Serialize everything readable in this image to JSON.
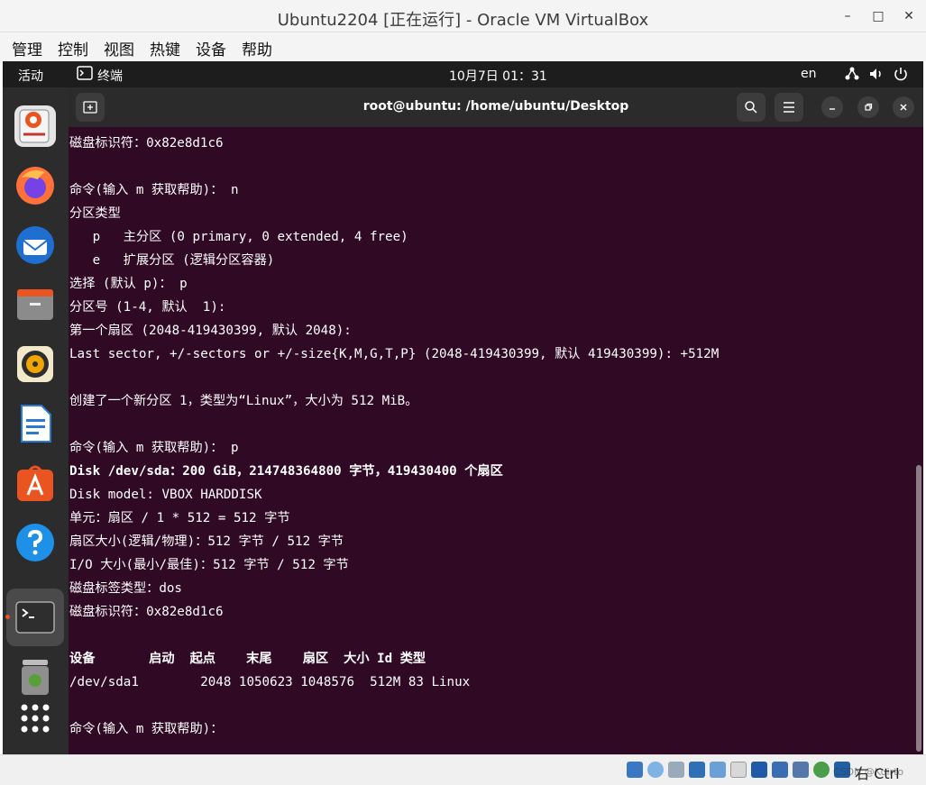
{
  "window": {
    "title": "Ubuntu2204 [正在运行] - Oracle VM VirtualBox",
    "minimize": "–",
    "maximize": "□",
    "close": "✕"
  },
  "menubar": [
    "管理",
    "控制",
    "视图",
    "热键",
    "设备",
    "帮助"
  ],
  "topbar": {
    "activities": "活动",
    "app_icon": "terminal-icon",
    "app_name": "终端",
    "clock": "10月7日 01：31",
    "lang": "en"
  },
  "dock": [
    "ubuntu-software-icon",
    "firefox-icon",
    "thunderbird-icon",
    "files-icon",
    "rhythmbox-icon",
    "libreoffice-writer-icon",
    "app-center-icon",
    "help-icon",
    "terminal-icon",
    "trash-icon",
    "show-apps-icon"
  ],
  "terminal": {
    "title": "root@ubuntu: /home/ubuntu/Desktop",
    "lines": [
      "磁盘标识符：0x82e8d1c6",
      "",
      "命令(输入 m 获取帮助)： n",
      "分区类型",
      "   p   主分区 (0 primary, 0 extended, 4 free)",
      "   e   扩展分区 (逻辑分区容器)",
      "选择 (默认 p)： p",
      "分区号 (1-4, 默认  1):",
      "第一个扇区 (2048-419430399, 默认 2048):",
      "Last sector, +/-sectors or +/-size{K,M,G,T,P} (2048-419430399, 默认 419430399): +512M",
      "",
      "创建了一个新分区 1，类型为“Linux”，大小为 512 MiB。",
      "",
      "命令(输入 m 获取帮助)： p",
      "Disk /dev/sda：200 GiB，214748364800 字节，419430400 个扇区",
      "Disk model: VBOX HARDDISK",
      "单元：扇区 / 1 * 512 = 512 字节",
      "扇区大小(逻辑/物理)：512 字节 / 512 字节",
      "I/O 大小(最小/最佳)：512 字节 / 512 字节",
      "磁盘标签类型：dos",
      "磁盘标识符：0x82e8d1c6",
      "",
      "设备       启动  起点    末尾    扇区  大小 Id 类型",
      "/dev/sda1        2048 1050623 1048576  512M 83 Linux",
      "",
      "命令(输入 m 获取帮助)："
    ],
    "bold_lines": [
      14,
      22
    ]
  },
  "statusbar": {
    "host_key": "右 Ctrl",
    "watermark": "CSDN @Kuirto"
  },
  "colors": {
    "terminal_bg": "#300a24",
    "accent": "#e95420"
  }
}
